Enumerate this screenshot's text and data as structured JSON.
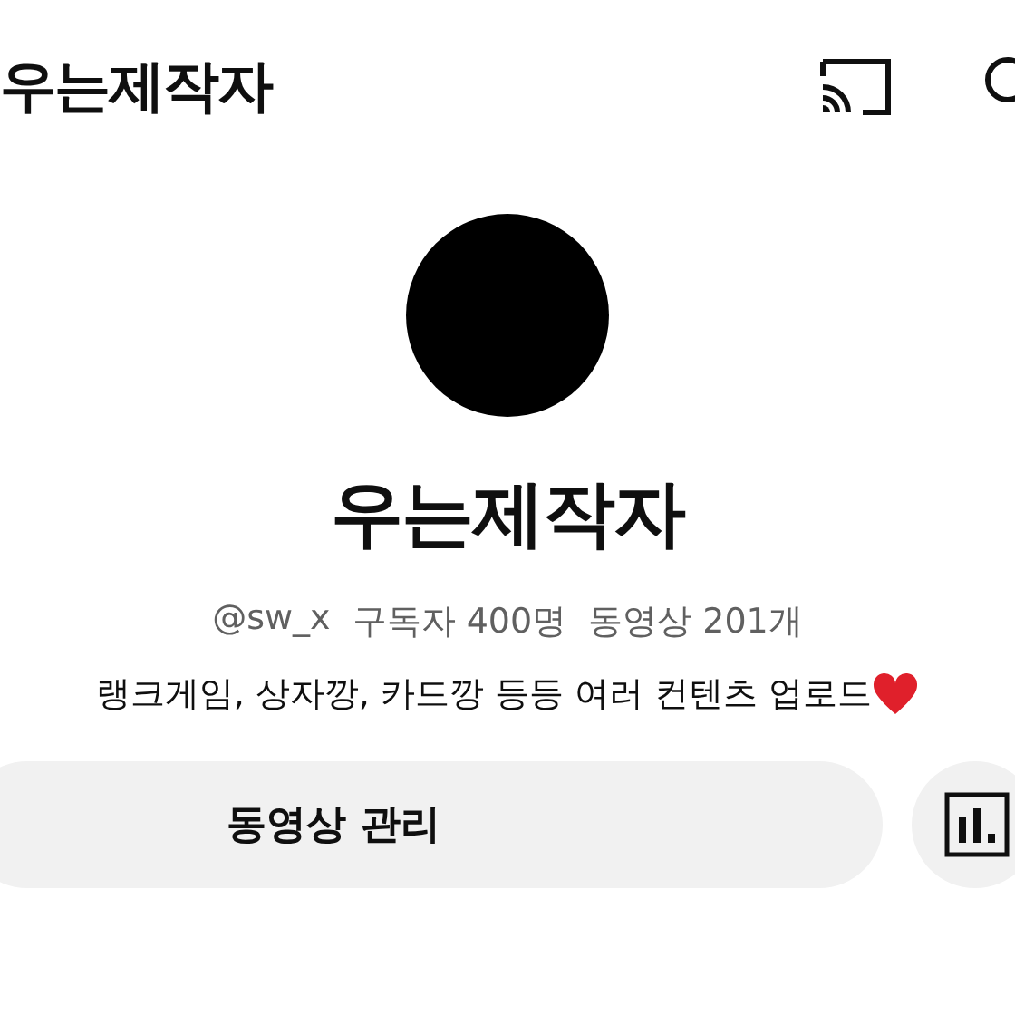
{
  "top_bar": {
    "title": "우는제작자"
  },
  "channel": {
    "name": "우는제작자",
    "handle": "@sw_x",
    "subscribers": "구독자 400명",
    "videos": "동영상 201개",
    "description": "랭크게임, 상자깡, 카드깡 등등 여러 컨텐츠 업로드"
  },
  "actions": {
    "manage_button": "동영상 관리"
  }
}
